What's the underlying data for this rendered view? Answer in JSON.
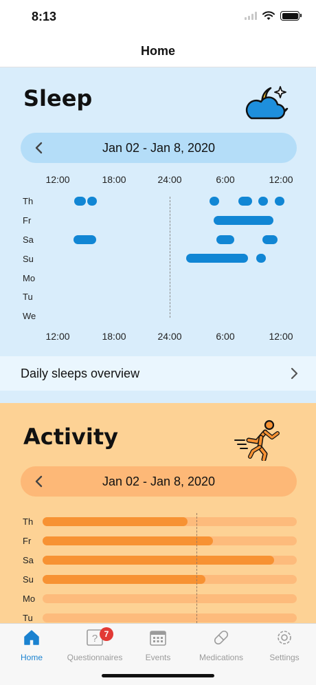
{
  "status_bar": {
    "time": "8:13"
  },
  "nav": {
    "title": "Home"
  },
  "sleep": {
    "title": "Sleep",
    "range": "Jan 02 - Jan 8, 2020",
    "time_axis": [
      "12:00",
      "18:00",
      "24:00",
      "6:00",
      "12:00"
    ],
    "days": [
      "Th",
      "Fr",
      "Sa",
      "Su",
      "Mo",
      "Tu",
      "We"
    ],
    "overview_label": "Daily sleeps overview",
    "colors": {
      "background": "#d9edfb",
      "bar": "#1186d4",
      "range_pill": "#b4ddf8"
    }
  },
  "activity": {
    "title": "Activity",
    "range": "Jan 02 - Jan 8, 2020",
    "days": [
      "Th",
      "Fr",
      "Sa",
      "Su",
      "Mo",
      "Tu"
    ],
    "levels": [
      0.57,
      0.67,
      0.91,
      0.64,
      0,
      0
    ],
    "colors": {
      "background": "#fdd295",
      "fill": "#f79233",
      "track": "#fdbb7c"
    }
  },
  "tabs": [
    {
      "label": "Home",
      "icon": "home-icon",
      "active": true
    },
    {
      "label": "Questionnaires",
      "icon": "questionnaire-icon",
      "badge": "7"
    },
    {
      "label": "Events",
      "icon": "calendar-icon"
    },
    {
      "label": "Medications",
      "icon": "pill-icon"
    },
    {
      "label": "Settings",
      "icon": "settings-icon"
    }
  ]
}
